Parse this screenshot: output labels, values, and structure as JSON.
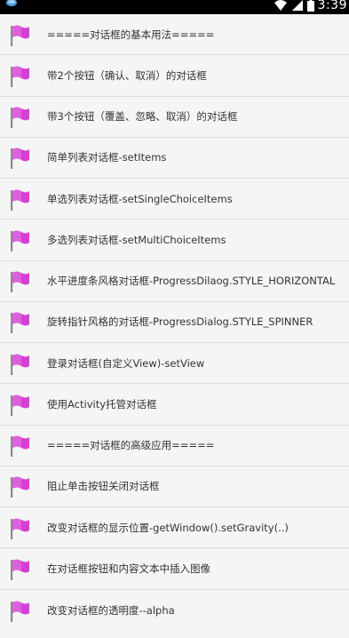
{
  "status_bar": {
    "time": "3:39",
    "icons": [
      "app-notification-icon",
      "wifi-icon",
      "signal-icon",
      "battery-icon"
    ]
  },
  "list": {
    "item_icon": "flag-icon",
    "item_icon_color": "#d63fd6",
    "items": [
      {
        "label": "=====对话框的基本用法====="
      },
      {
        "label": "带2个按钮（确认、取消）的对话框"
      },
      {
        "label": "带3个按钮（覆盖、忽略、取消）的对话框"
      },
      {
        "label": "简单列表对话框-setItems"
      },
      {
        "label": "单选列表对话框-setSingleChoiceItems"
      },
      {
        "label": "多选列表对话框-setMultiChoiceItems"
      },
      {
        "label": "水平进度条风格对话框-ProgressDilaog.STYLE_HORIZONTAL"
      },
      {
        "label": "旋转指针风格的对话框-ProgressDialog.STYLE_SPINNER"
      },
      {
        "label": "登录对话框(自定义View)-setView"
      },
      {
        "label": "使用Activity托管对话框"
      },
      {
        "label": "=====对话框的高级应用====="
      },
      {
        "label": "阻止单击按钮关闭对话框"
      },
      {
        "label": "改变对话框的显示位置-getWindow().setGravity(..)"
      },
      {
        "label": "在对话框按钮和内容文本中插入图像"
      },
      {
        "label": "改变对话框的透明度--alpha"
      }
    ]
  }
}
